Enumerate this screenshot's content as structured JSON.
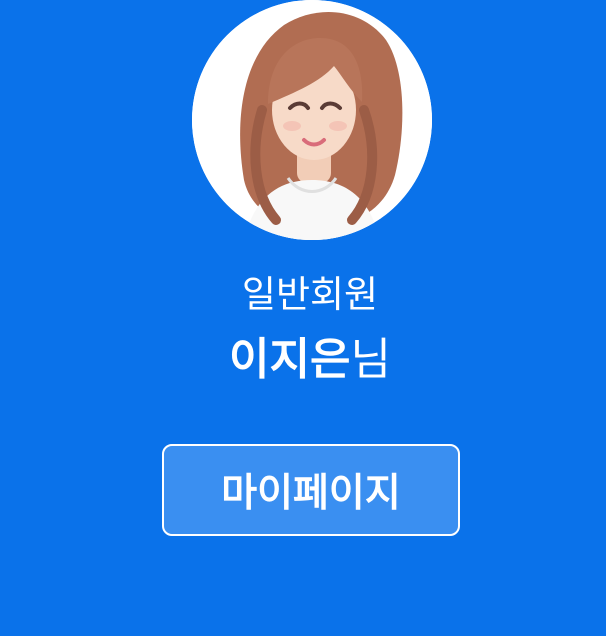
{
  "profile": {
    "member_type": "일반회원",
    "name": "이지은",
    "name_suffix": "님"
  },
  "actions": {
    "mypage_label": "마이페이지"
  },
  "colors": {
    "background": "#0a72ea",
    "button_fill": "#3a8ff1",
    "text": "#ffffff"
  },
  "icons": {
    "avatar": "profile-photo"
  }
}
